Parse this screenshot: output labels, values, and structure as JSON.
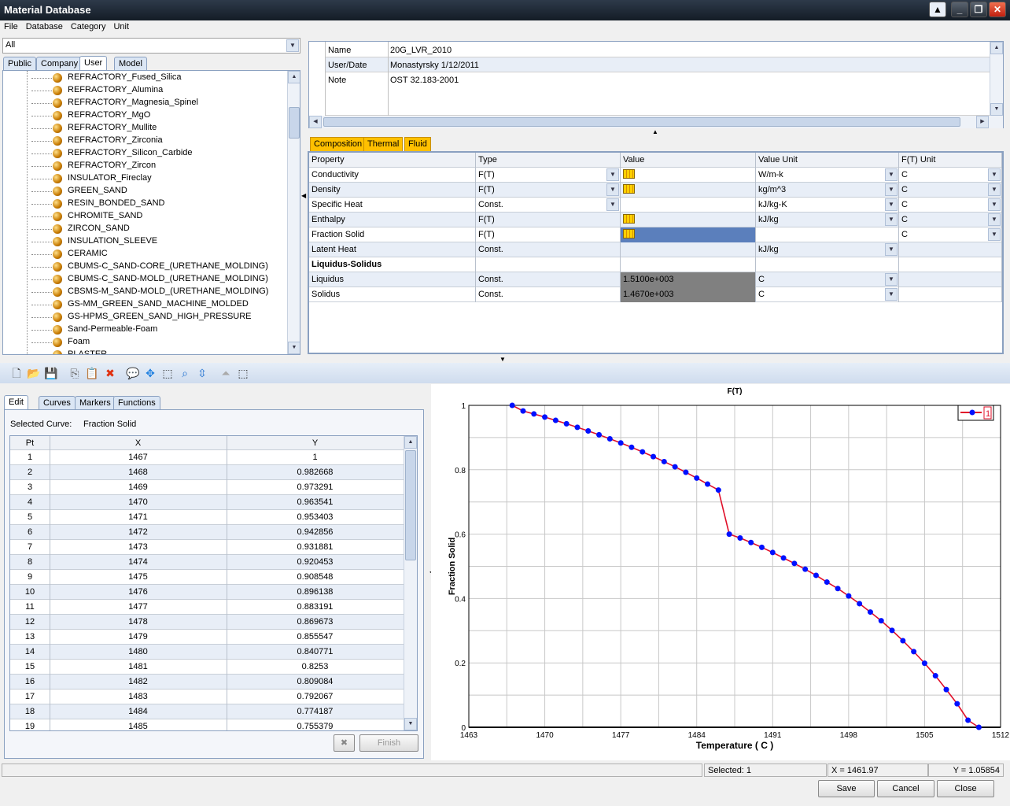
{
  "window": {
    "title": "Material Database"
  },
  "menu": [
    "File",
    "Database",
    "Category",
    "Unit"
  ],
  "filter": {
    "value": "All"
  },
  "left_tabs": [
    "Public",
    "Company",
    "User",
    "Model"
  ],
  "left_active_tab": "User",
  "tree_items": [
    "REFRACTORY_Fused_Silica",
    "REFRACTORY_Alumina",
    "REFRACTORY_Magnesia_Spinel",
    "REFRACTORY_MgO",
    "REFRACTORY_Mullite",
    "REFRACTORY_Zirconia",
    "REFRACTORY_Silicon_Carbide",
    "REFRACTORY_Zircon",
    "INSULATOR_Fireclay",
    "GREEN_SAND",
    "RESIN_BONDED_SAND",
    "CHROMITE_SAND",
    "ZIRCON_SAND",
    "INSULATION_SLEEVE",
    "CERAMIC",
    "CBUMS-C_SAND-CORE_(URETHANE_MOLDING)",
    "CBUMS-C_SAND-MOLD_(URETHANE_MOLDING)",
    "CBSMS-M_SAND-MOLD_(URETHANE_MOLDING)",
    "GS-MM_GREEN_SAND_MACHINE_MOLDED",
    "GS-HPMS_GREEN_SAND_HIGH_PRESSURE",
    "Sand-Permeable-Foam",
    "Foam",
    "PLASTER"
  ],
  "info": [
    {
      "label": "Name",
      "value": "20G_LVR_2010"
    },
    {
      "label": "User/Date",
      "value": "Monastyrsky 1/12/2011"
    },
    {
      "label": "Note",
      "value": "OST 32.183-2001"
    }
  ],
  "prop_tabs": [
    "Composition",
    "Thermal",
    "Fluid"
  ],
  "prop_headers": [
    "Property",
    "Type",
    "Value",
    "Value Unit",
    "F(T) Unit"
  ],
  "properties": [
    {
      "property": "Conductivity",
      "type": "F(T)",
      "type_dd": true,
      "value": "",
      "value_icon": "function-chart-icon",
      "unit": "W/m-k",
      "unit_dd": true,
      "ft_unit": "C",
      "ft_dd": true
    },
    {
      "property": "Density",
      "type": "F(T)",
      "type_dd": true,
      "value": "",
      "value_icon": "function-chart-icon",
      "unit": "kg/m^3",
      "unit_dd": true,
      "ft_unit": "C",
      "ft_dd": true
    },
    {
      "property": "Specific Heat",
      "type": "Const.",
      "type_dd": true,
      "value": "",
      "unit": "kJ/kg-K",
      "unit_dd": true,
      "ft_unit": "C",
      "ft_dd": true
    },
    {
      "property": "Enthalpy",
      "type": "F(T)",
      "value": "",
      "value_icon": "function-chart-icon",
      "unit": "kJ/kg",
      "unit_dd": true,
      "ft_unit": "C",
      "ft_dd": true
    },
    {
      "property": "Fraction Solid",
      "type": "F(T)",
      "value": "",
      "value_icon": "function-chart-icon",
      "selected": true,
      "unit": "",
      "ft_unit": "C",
      "ft_dd": true
    },
    {
      "property": "Latent Heat",
      "type": "Const.",
      "value": "",
      "unit": "kJ/kg",
      "unit_dd": true,
      "ft_unit": ""
    },
    {
      "property": "Liquidus-Solidus",
      "group": true
    },
    {
      "property": "Liquidus",
      "type": "Const.",
      "value": "1.5100e+003",
      "readonly": true,
      "unit": "C",
      "unit_dd": true,
      "ft_unit": ""
    },
    {
      "property": "Solidus",
      "type": "Const.",
      "value": "1.4670e+003",
      "readonly": true,
      "unit": "C",
      "unit_dd": true,
      "ft_unit": ""
    }
  ],
  "toolbar_icons": [
    "new-icon",
    "open-icon",
    "save-icon",
    "copy-icon",
    "paste-icon",
    "delete-icon",
    "comment-icon",
    "pan-icon",
    "zoom-box-icon",
    "zoom-fit-icon",
    "zoom-center-icon",
    "scroll-up-icon",
    "select-point-icon"
  ],
  "edit_tabs": [
    "Edit",
    "Curves",
    "Markers",
    "Functions"
  ],
  "selected_curve": {
    "label": "Selected Curve:",
    "value": "Fraction Solid"
  },
  "points_headers": [
    "Pt",
    "X",
    "Y"
  ],
  "points": [
    [
      "1",
      "1467",
      "1"
    ],
    [
      "2",
      "1468",
      "0.982668"
    ],
    [
      "3",
      "1469",
      "0.973291"
    ],
    [
      "4",
      "1470",
      "0.963541"
    ],
    [
      "5",
      "1471",
      "0.953403"
    ],
    [
      "6",
      "1472",
      "0.942856"
    ],
    [
      "7",
      "1473",
      "0.931881"
    ],
    [
      "8",
      "1474",
      "0.920453"
    ],
    [
      "9",
      "1475",
      "0.908548"
    ],
    [
      "10",
      "1476",
      "0.896138"
    ],
    [
      "11",
      "1477",
      "0.883191"
    ],
    [
      "12",
      "1478",
      "0.869673"
    ],
    [
      "13",
      "1479",
      "0.855547"
    ],
    [
      "14",
      "1480",
      "0.840771"
    ],
    [
      "15",
      "1481",
      "0.8253"
    ],
    [
      "16",
      "1482",
      "0.809084"
    ],
    [
      "17",
      "1483",
      "0.792067"
    ],
    [
      "18",
      "1484",
      "0.774187"
    ],
    [
      "19",
      "1485",
      "0.755379"
    ]
  ],
  "finish_label": "Finish",
  "chart_data": {
    "type": "line",
    "title": "F(T)",
    "xlabel": "Temperature ( C )",
    "ylabel": "Fraction Solid",
    "xlim": [
      1463,
      1512
    ],
    "ylim": [
      0,
      1
    ],
    "xticks": [
      1463,
      1470,
      1477,
      1484,
      1491,
      1498,
      1505,
      1512
    ],
    "yticks": [
      0,
      0.2,
      0.4,
      0.6,
      0.8,
      1
    ],
    "grid": true,
    "legend": "top-right",
    "series": [
      {
        "name": "1",
        "color": "#e0102a",
        "marker_color": "#0010ff",
        "x": [
          1467,
          1468,
          1469,
          1470,
          1471,
          1472,
          1473,
          1474,
          1475,
          1476,
          1477,
          1478,
          1479,
          1480,
          1481,
          1482,
          1483,
          1484,
          1485,
          1486,
          1487,
          1488,
          1489,
          1490,
          1491,
          1492,
          1493,
          1494,
          1495,
          1496,
          1497,
          1498,
          1499,
          1500,
          1501,
          1502,
          1503,
          1504,
          1505,
          1506,
          1507,
          1508,
          1509,
          1510
        ],
        "y": [
          1,
          0.982668,
          0.973291,
          0.963541,
          0.953403,
          0.942856,
          0.931881,
          0.920453,
          0.908548,
          0.896138,
          0.883191,
          0.869673,
          0.855547,
          0.840771,
          0.8253,
          0.809084,
          0.792067,
          0.774187,
          0.755379,
          0.737,
          0.6,
          0.588,
          0.574,
          0.559,
          0.543,
          0.526,
          0.509,
          0.491,
          0.472,
          0.451,
          0.431,
          0.408,
          0.384,
          0.358,
          0.331,
          0.301,
          0.269,
          0.235,
          0.199,
          0.16,
          0.117,
          0.073,
          0.022,
          0
        ]
      }
    ]
  },
  "status": {
    "left": "",
    "selected": "Selected: 1",
    "x": "X = 1461.97",
    "y": "Y = 1.05854"
  },
  "buttons": {
    "save": "Save",
    "cancel": "Cancel",
    "close": "Close"
  }
}
